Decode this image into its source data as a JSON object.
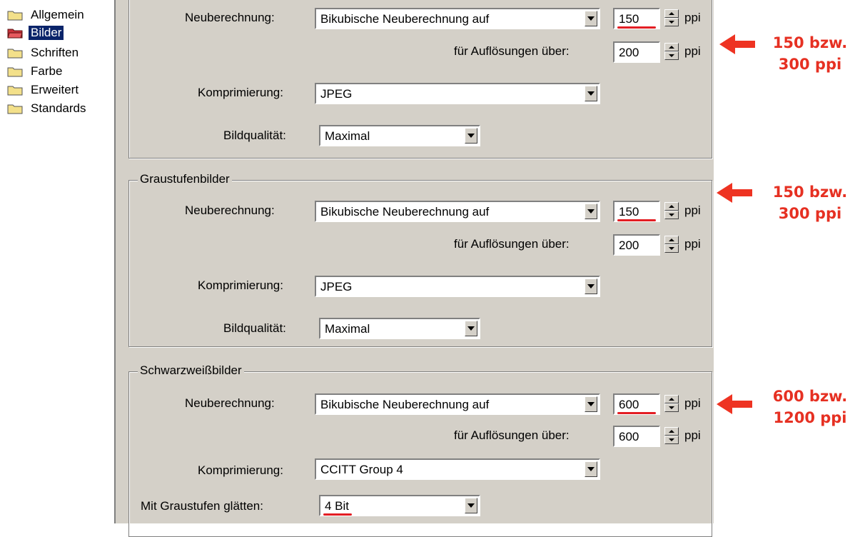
{
  "sidebar": {
    "items": [
      {
        "label": "Allgemein",
        "selected": false,
        "icon": "folder-icon"
      },
      {
        "label": "Bilder",
        "selected": true,
        "icon": "folder-open-icon"
      },
      {
        "label": "Schriften",
        "selected": false,
        "icon": "folder-icon"
      },
      {
        "label": "Farbe",
        "selected": false,
        "icon": "folder-icon"
      },
      {
        "label": "Erweitert",
        "selected": false,
        "icon": "folder-icon"
      },
      {
        "label": "Standards",
        "selected": false,
        "icon": "folder-icon"
      }
    ]
  },
  "color_group": {
    "resample_label": "Neuberechnung:",
    "resample_value": "Bikubische Neuberechnung auf",
    "ppi_value": "150",
    "unit": "ppi",
    "above_label": "für Auflösungen über:",
    "above_value": "200",
    "compression_label": "Komprimierung:",
    "compression_value": "JPEG",
    "quality_label": "Bildqualität:",
    "quality_value": "Maximal"
  },
  "gray_group": {
    "title": "Graustufenbilder",
    "resample_label": "Neuberechnung:",
    "resample_value": "Bikubische Neuberechnung auf",
    "ppi_value": "150",
    "unit": "ppi",
    "above_label": "für Auflösungen über:",
    "above_value": "200",
    "compression_label": "Komprimierung:",
    "compression_value": "JPEG",
    "quality_label": "Bildqualität:",
    "quality_value": "Maximal"
  },
  "mono_group": {
    "title": "Schwarzweißbilder",
    "resample_label": "Neuberechnung:",
    "resample_value": "Bikubische Neuberechnung auf",
    "ppi_value": "600",
    "unit": "ppi",
    "above_label": "für Auflösungen über:",
    "above_value": "600",
    "compression_label": "Komprimierung:",
    "compression_value": "CCITT Group 4",
    "smooth_label": "Mit Graustufen glätten:",
    "smooth_value": "4 Bit"
  },
  "annotations": [
    {
      "line1": "150 bzw.",
      "line2": "300 ppi"
    },
    {
      "line1": "150 bzw.",
      "line2": "300 ppi"
    },
    {
      "line1": "600 bzw.",
      "line2": "1200 ppi"
    }
  ],
  "colors": {
    "highlight": "#e31e24",
    "annotation": "#e63022",
    "selection": "#0a246a",
    "dialog": "#d4d0c8"
  }
}
